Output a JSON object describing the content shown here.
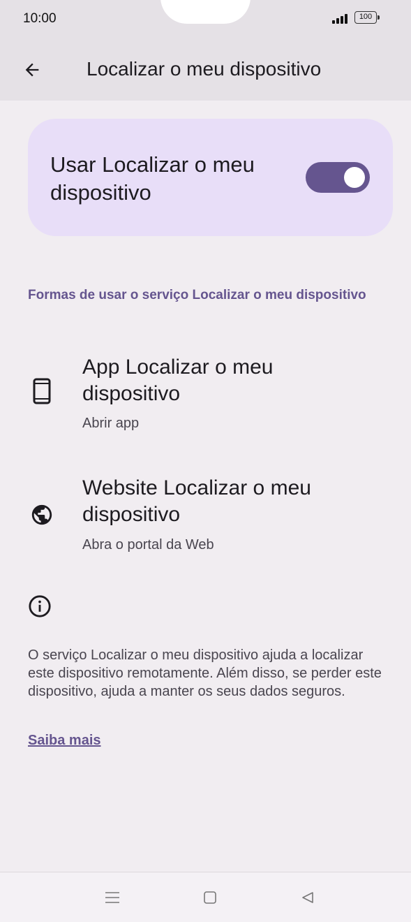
{
  "status_bar": {
    "time": "10:00",
    "battery_level": "100"
  },
  "app_bar": {
    "title": "Localizar o meu dispositivo"
  },
  "toggle": {
    "label": "Usar Localizar o meu dispositivo",
    "state": "on"
  },
  "section": {
    "header": "Formas de usar o serviço Localizar o meu dispositivo"
  },
  "options": [
    {
      "title": "App Localizar o meu dispositivo",
      "subtitle": "Abrir app",
      "icon": "phone-icon"
    },
    {
      "title": "Website Localizar o meu dispositivo",
      "subtitle": "Abra o portal da Web",
      "icon": "globe-icon"
    }
  ],
  "info": {
    "icon": "info-icon",
    "text": "O serviço Localizar o meu dispositivo ajuda a localizar este dispositivo remotamente. Além disso, se perder este dispositivo, ajuda a manter os seus dados seguros.",
    "link": "Saiba mais"
  },
  "colors": {
    "accent": "#65558F",
    "card": "#E8DEF8",
    "background": "#F1EDF1",
    "app_bar": "#E5E1E6"
  }
}
